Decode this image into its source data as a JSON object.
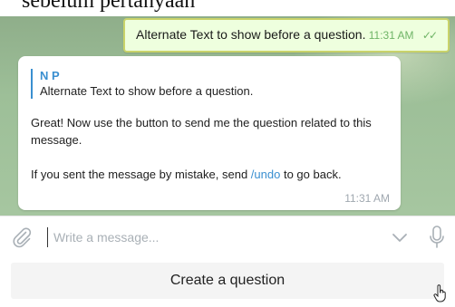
{
  "top_caption": "sebelum pertanyaan",
  "outgoing_message": {
    "text": "Alternate Text to show before a question.",
    "time": "11:31 AM",
    "status_icon": "double-check-icon"
  },
  "incoming_message": {
    "reply": {
      "name": "N P",
      "text": "Alternate Text to show before a question."
    },
    "paragraph1": "Great! Now use the button to send me the question related to this message.",
    "paragraph2_prefix": "If you sent the message by mistake, send ",
    "undo_command": "/undo",
    "paragraph2_suffix": " to go back.",
    "time": "11:31 AM"
  },
  "composer": {
    "placeholder": "Write a message...",
    "attach_icon": "paperclip-icon",
    "expand_icon": "chevron-down-icon",
    "mic_icon": "microphone-icon"
  },
  "keyboard": {
    "button_label": "Create a question"
  },
  "colors": {
    "accent": "#3a8fd0",
    "outgoing_bubble": "#eeffde",
    "check": "#6fb466"
  }
}
